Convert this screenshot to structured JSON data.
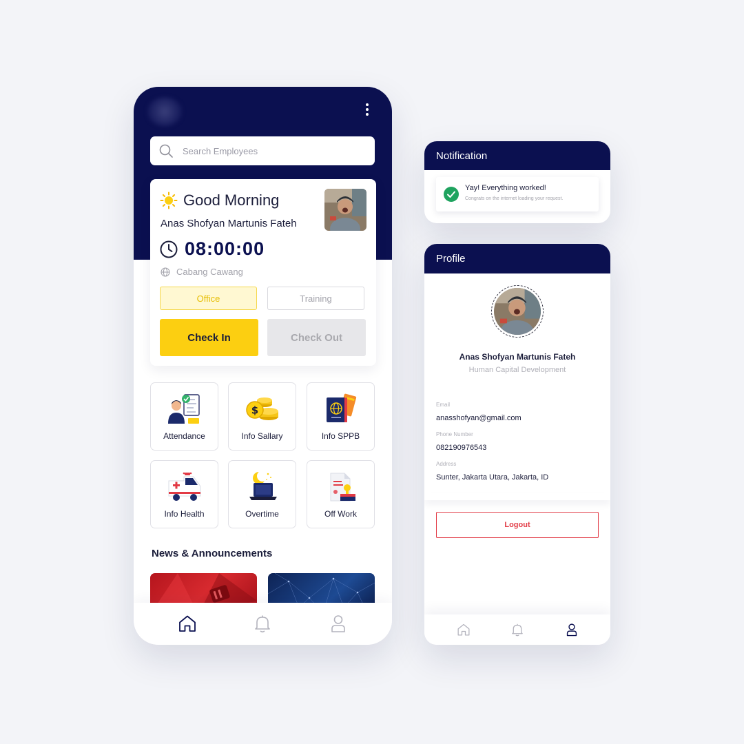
{
  "colors": {
    "navy": "#0b1050",
    "yellow": "#fccf11",
    "success": "#1fa35f",
    "danger": "#e23a45"
  },
  "home": {
    "search": {
      "placeholder": "Search Employees"
    },
    "greeting": "Good Morning",
    "user_name": "Anas Shofyan Martunis Fateh",
    "time": "08:00:00",
    "location": "Cabang Cawang",
    "work_types": [
      {
        "label": "Office",
        "selected": true
      },
      {
        "label": "Training",
        "selected": false
      }
    ],
    "check_in_label": "Check In",
    "check_out_label": "Check Out",
    "menu": [
      {
        "label": "Attendance",
        "icon": "attendance-icon"
      },
      {
        "label": "Info Sallary",
        "icon": "coins-icon"
      },
      {
        "label": "Info SPPB",
        "icon": "passport-icon"
      },
      {
        "label": "Info Health",
        "icon": "ambulance-icon"
      },
      {
        "label": "Overtime",
        "icon": "night-laptop-icon"
      },
      {
        "label": "Off Work",
        "icon": "document-leave-icon"
      }
    ],
    "news_title": "News & Announcements",
    "nav": [
      "home-icon",
      "bell-icon",
      "user-icon"
    ]
  },
  "notification": {
    "title": "Notification",
    "toast_title": "Yay! Everything worked!",
    "toast_body": "Congrats on the internet loading your request."
  },
  "profile": {
    "title": "Profile",
    "name": "Anas Shofyan Martunis Fateh",
    "role": "Human Capital Development",
    "fields": [
      {
        "label": "Email",
        "value": "anasshofyan@gmail.com"
      },
      {
        "label": "Phone Number",
        "value": "082190976543"
      },
      {
        "label": "Address",
        "value": "Sunter, Jakarta Utara, Jakarta, ID"
      }
    ],
    "logout_label": "Logout"
  }
}
